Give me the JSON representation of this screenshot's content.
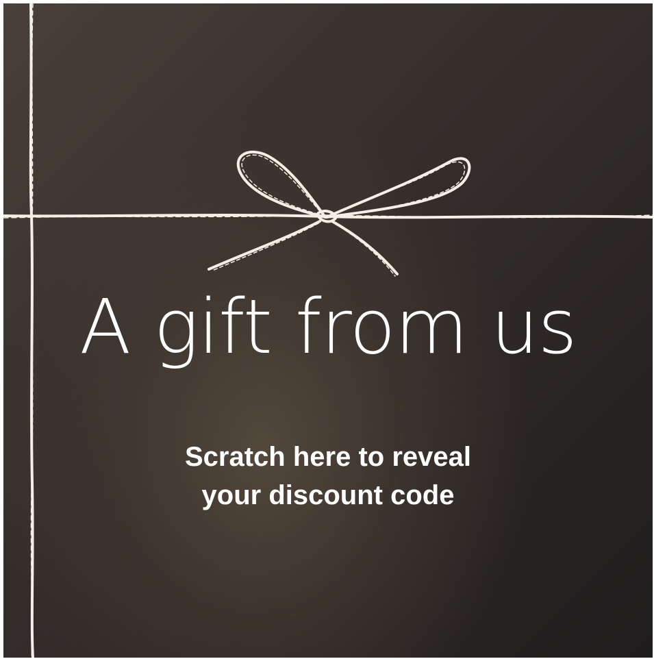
{
  "card": {
    "title": "A gift from us",
    "subtitle_line1": "Scratch here to reveal",
    "subtitle_line2": "your discount code"
  },
  "icons": {
    "twine": "twine-ribbon-icon",
    "bow": "bow-icon"
  },
  "colors": {
    "background_dark": "#1f1c1d",
    "background_light": "#584c3e",
    "text": "#ffffff",
    "twine": "#f4efe6"
  }
}
